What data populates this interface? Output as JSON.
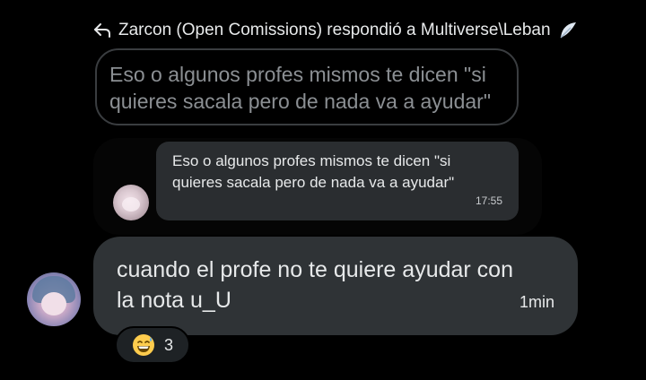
{
  "reply": {
    "header_text": "Zarcon (Open Comissions) respondió a Multiverse\\Leban",
    "reply_icon": "reply-arrow-icon",
    "badge_icon": "feather-icon",
    "quoted_text": "Eso o algunos profes mismos te dicen \"si quieres sacala pero de nada va a ayudar\""
  },
  "embedded": {
    "message": "Eso o algunos profes mismos te dicen \"si quieres sacala pero de nada va a ayudar\"",
    "time": "17:55"
  },
  "message": {
    "text": "cuando el profe no te quiere ayudar con la nota u_U",
    "time": "1min"
  },
  "reaction": {
    "emoji": "grinning-sweat-icon",
    "count": "3"
  },
  "colors": {
    "background": "#000000",
    "bubble": "#2f3336",
    "quoted_text": "#8b8f93",
    "text": "#e7e9ea"
  }
}
